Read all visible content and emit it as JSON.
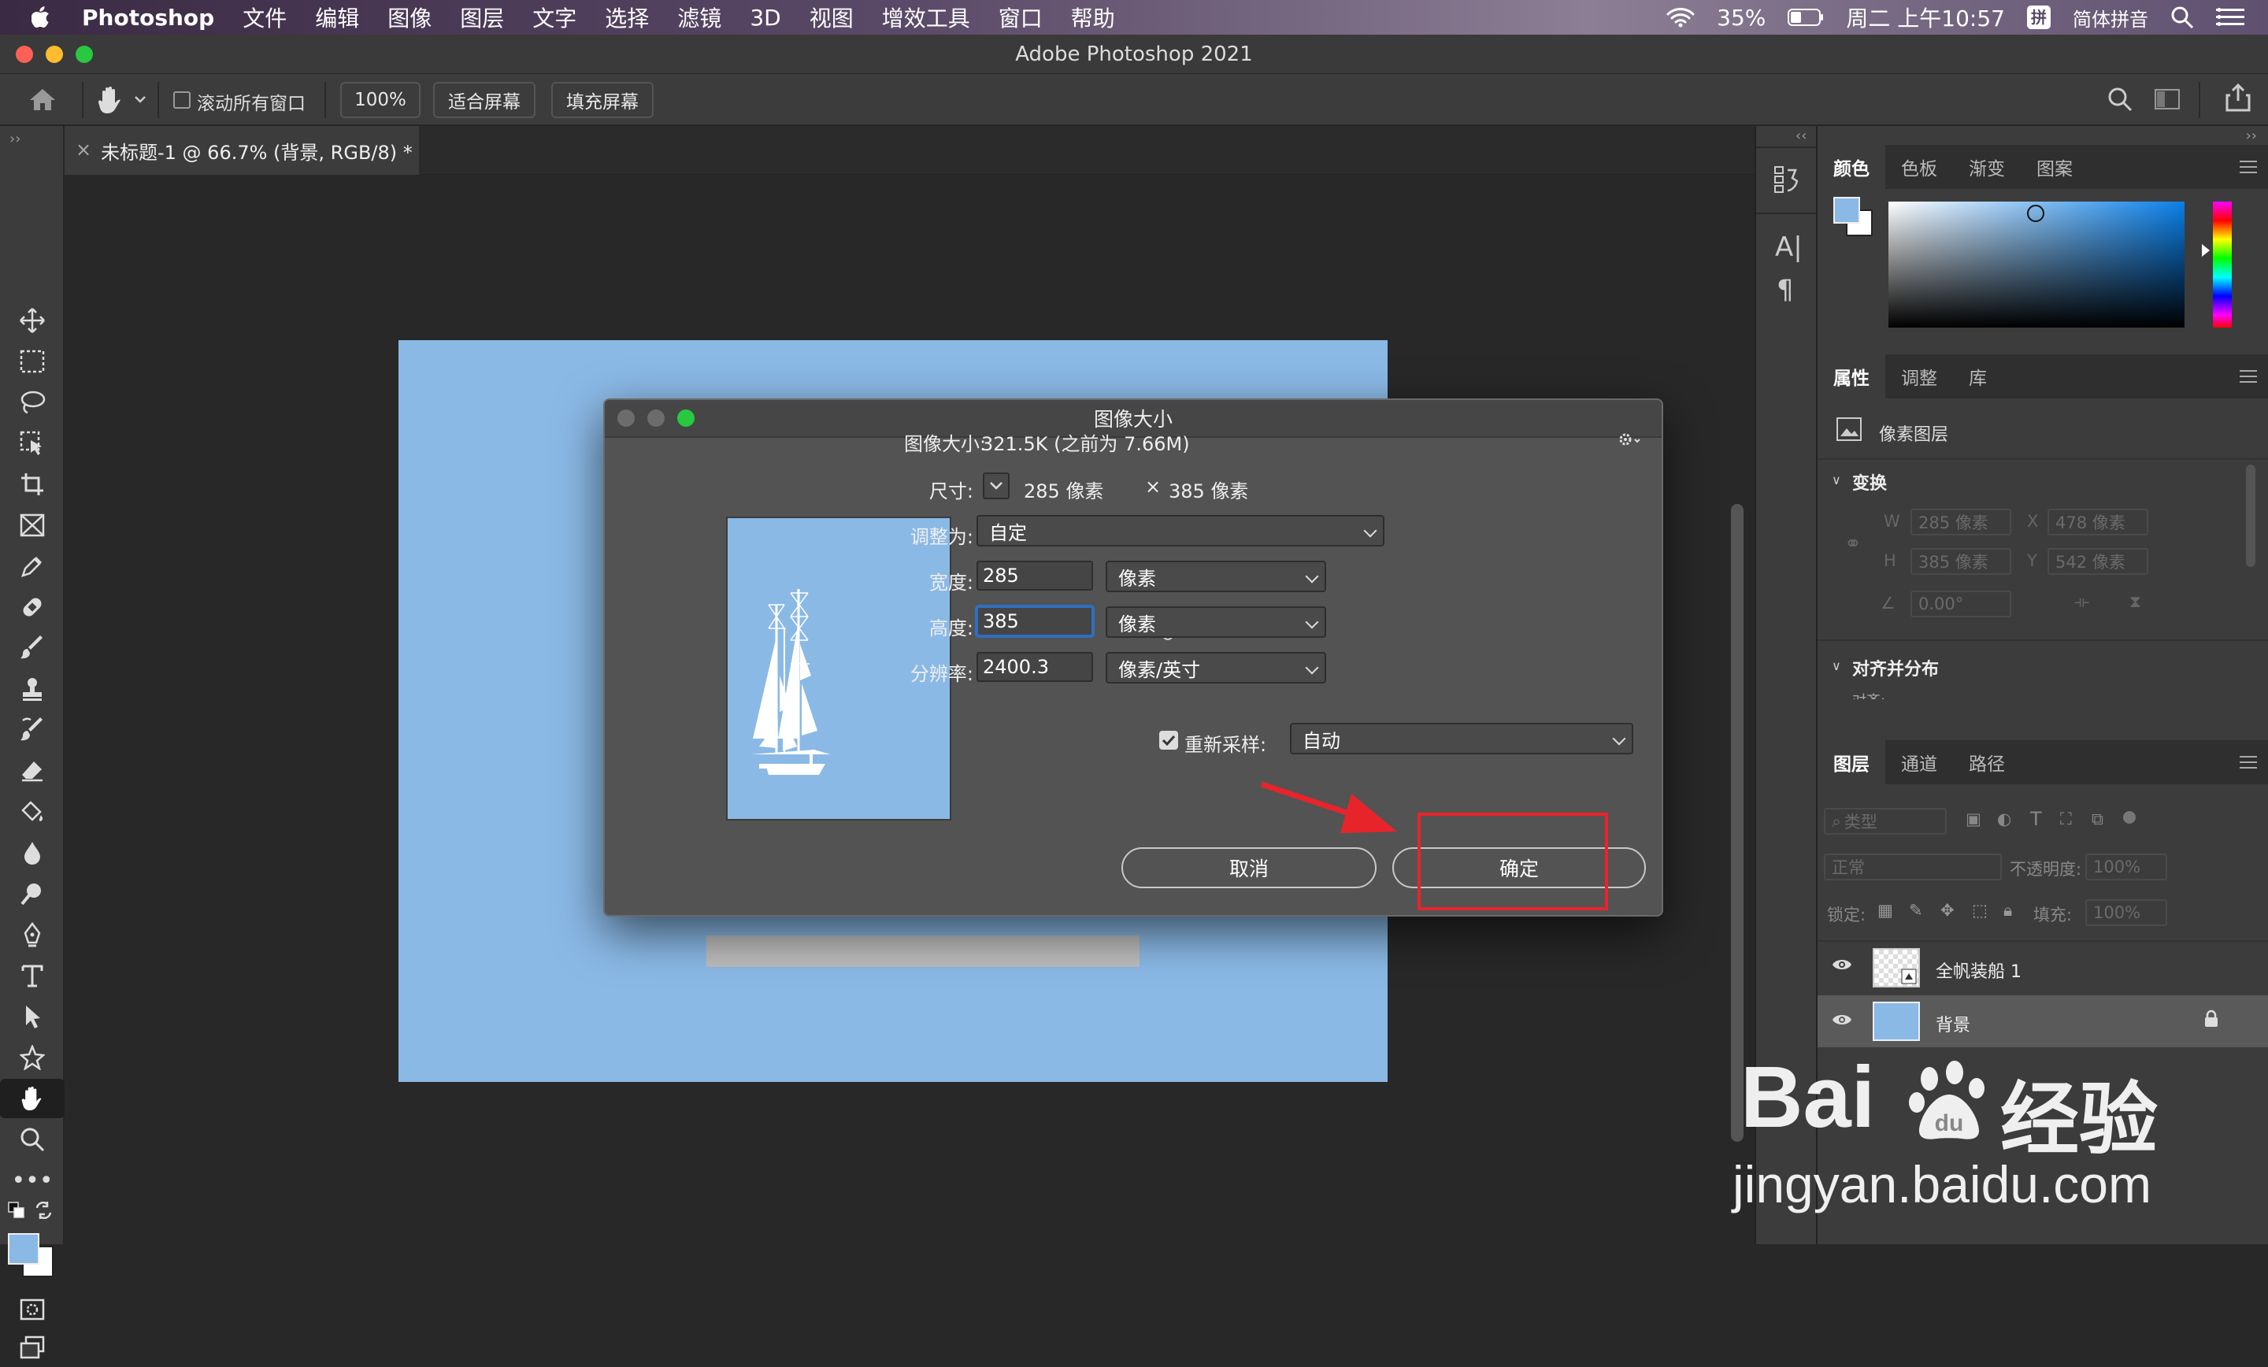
{
  "menubar": {
    "app_name": "Photoshop",
    "items": [
      "文件",
      "编辑",
      "图像",
      "图层",
      "文字",
      "选择",
      "滤镜",
      "3D",
      "视图",
      "增效工具",
      "窗口",
      "帮助"
    ],
    "battery": "35%",
    "clock": "周二 上午10:57",
    "input_method": "简体拼音"
  },
  "window": {
    "title": "Adobe Photoshop 2021"
  },
  "options": {
    "scroll_all_label": "滚动所有窗口",
    "zoom_btn": "100%",
    "fit_btn": "适合屏幕",
    "fill_btn": "填充屏幕"
  },
  "document": {
    "tab_label": "未标题-1 @ 66.7% (背景, RGB/8) *"
  },
  "right_panel": {
    "color_tabs": [
      "颜色",
      "色板",
      "渐变",
      "图案"
    ],
    "prop_tabs": [
      "属性",
      "调整",
      "库"
    ],
    "pixel_layer_label": "像素图层",
    "transform_label": "变换",
    "w_label": "W",
    "w_val": "285 像素",
    "x_label": "X",
    "x_val": "478 像素",
    "h_label": "H",
    "h_val": "385 像素",
    "y_label": "Y",
    "y_val": "542 像素",
    "angle_val": "0.00°",
    "align_label": "对齐并分布",
    "align_sub": "对齐:",
    "layers_tabs": [
      "图层",
      "通道",
      "路径"
    ],
    "filter_kind": "类型",
    "blend_mode": "正常",
    "opacity_label": "不透明度:",
    "opacity_val": "100%",
    "lock_label": "锁定:",
    "fill_label": "填充:",
    "fill_val": "100%",
    "layers": [
      {
        "name": "全帆装船 1"
      },
      {
        "name": "背景"
      }
    ]
  },
  "dialog": {
    "title": "图像大小",
    "image_size_label": "图像大小:",
    "image_size_value": "321.5K (之前为 7.66M)",
    "dimensions_label": "尺寸:",
    "dim_w": "285 像素",
    "dim_x": "×",
    "dim_h": "385 像素",
    "fit_label": "调整为:",
    "fit_value": "自定",
    "width_label": "宽度:",
    "width_value": "285",
    "width_unit": "像素",
    "height_label": "高度:",
    "height_value": "385",
    "height_unit": "像素",
    "resolution_label": "分辨率:",
    "resolution_value": "2400.3",
    "resolution_unit": "像素/英寸",
    "resample_label": "重新采样:",
    "resample_value": "自动",
    "cancel_label": "取消",
    "ok_label": "确定"
  },
  "watermark": {
    "brand": "Bai",
    "brand_cn": "经验",
    "url": "jingyan.baidu.com"
  },
  "colors": {
    "canvas_blue": "#8ab9e6",
    "highlight_red": "#e8242b",
    "panel_bg": "#3c3c3c",
    "dialog_bg": "#535353"
  }
}
